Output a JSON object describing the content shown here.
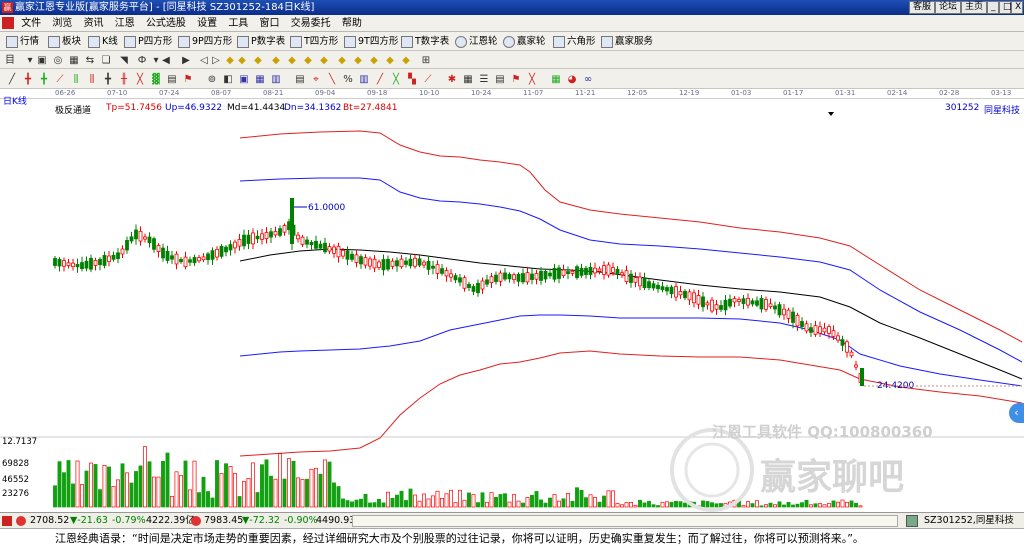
{
  "titlebar": {
    "app_icon": "赢",
    "title": "赢家江恩专业版[赢家服务平台] - [同星科技  SZ301252-184日K线]",
    "buttons": [
      "客服",
      "论坛",
      "主页"
    ],
    "window_controls": [
      "_",
      "□",
      "X"
    ]
  },
  "menu": [
    "文件",
    "浏览",
    "资讯",
    "江恩",
    "公式选股",
    "设置",
    "工具",
    "窗口",
    "交易委托",
    "帮助"
  ],
  "toolbar1": [
    {
      "label": "行情",
      "icon": "grid-icon"
    },
    {
      "label": "板块",
      "icon": "blocks-icon"
    },
    {
      "label": "K线",
      "icon": "candle-icon"
    },
    {
      "label": "P四方形",
      "icon": "p-square-icon"
    },
    {
      "label": "9P四方形",
      "icon": "9p-square-icon"
    },
    {
      "label": "P数字表",
      "icon": "p-table-icon"
    },
    {
      "label": "T四方形",
      "icon": "t-square-icon"
    },
    {
      "label": "9T四方形",
      "icon": "9t-square-icon"
    },
    {
      "label": "T数字表",
      "icon": "t-table-icon"
    },
    {
      "label": "江恩轮",
      "icon": "gann-wheel-icon"
    },
    {
      "label": "赢家轮",
      "icon": "winner-wheel-icon"
    },
    {
      "label": "六角形",
      "icon": "hexagon-icon"
    },
    {
      "label": "赢家服务",
      "icon": "service-icon"
    }
  ],
  "chart": {
    "period_label": "日K线",
    "indicator_name": "极反通道",
    "tp": "Tp=51.7456",
    "up": "Up=46.9322",
    "md": "Md=41.4434",
    "dn": "Dn=34.1362",
    "bt": "Bt=27.4841",
    "stock_code": "301252",
    "stock_name": "同星科技",
    "high_label": "61.0000",
    "low_label": "24.4200",
    "vol_axis": [
      "12.7137",
      "69828",
      "46552",
      "23276"
    ],
    "dates": [
      "06-26",
      "07-10",
      "07-24",
      "08-07",
      "08-21",
      "09-04",
      "09-18",
      "10-10",
      "10-24",
      "11-07",
      "11-21",
      "12-05",
      "12-19",
      "01-03",
      "01-17",
      "01-31",
      "02-14",
      "02-28",
      "03-13"
    ],
    "colors": {
      "up": "#ff0000",
      "down": "#008000",
      "upper_band": "#e02020",
      "mid_band": "#1a1aff",
      "center": "#000000",
      "volume_down": "#11a011"
    },
    "watermark_line1": "江恩工具软件  QQ:100800360",
    "watermark_line2": "赢家聊吧"
  },
  "status": {
    "sh_index": "2708.52",
    "sh_change": "▼-21.63",
    "sh_pct": "-0.79%",
    "sh_amount": "4222.39亿",
    "sz_index": "7983.45",
    "sz_change": "▼-72.32",
    "sz_pct": "-0.90%",
    "sz_amount": "4490.93",
    "current": "SZ301252,同星科技"
  },
  "quote": "江恩经典语录：“时间是决定市场走势的重要因素，经过详细研究大市及个别股票的过往记录，你将可以证明，历史确实重复发生；而了解过往，你将可以预测将来。”。"
}
